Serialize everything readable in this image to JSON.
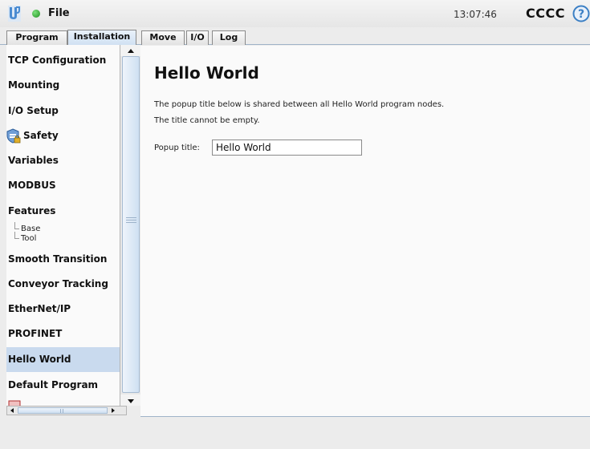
{
  "titlebar": {
    "file_label": "File",
    "time": "13:07:46",
    "robot_name": "CCCC",
    "help_symbol": "?"
  },
  "tabs": [
    {
      "label": "Program",
      "active": false
    },
    {
      "label": "Installation",
      "active": true
    },
    {
      "label": "Move",
      "active": false
    },
    {
      "label": "I/O",
      "active": false
    },
    {
      "label": "Log",
      "active": false
    }
  ],
  "sidebar": {
    "items": [
      {
        "label": "TCP Configuration"
      },
      {
        "label": "Mounting"
      },
      {
        "label": "I/O Setup"
      },
      {
        "label": "Safety",
        "icon": "shield-lock-icon"
      },
      {
        "label": "Variables"
      },
      {
        "label": "MODBUS"
      },
      {
        "label": "Features",
        "children": [
          "Base",
          "Tool"
        ]
      },
      {
        "label": "Smooth Transition"
      },
      {
        "label": "Conveyor Tracking"
      },
      {
        "label": "EtherNet/IP"
      },
      {
        "label": "PROFINET"
      },
      {
        "label": "Hello World",
        "selected": true
      },
      {
        "label": "Default Program"
      }
    ]
  },
  "main": {
    "title": "Hello World",
    "description_1": "The popup title below is shared between all Hello World program nodes.",
    "description_2": "The title cannot be empty.",
    "popup_label": "Popup title:",
    "popup_value": "Hello World"
  },
  "colors": {
    "selected_bg": "#c9daee",
    "accent_blue": "#3b7fc4"
  }
}
